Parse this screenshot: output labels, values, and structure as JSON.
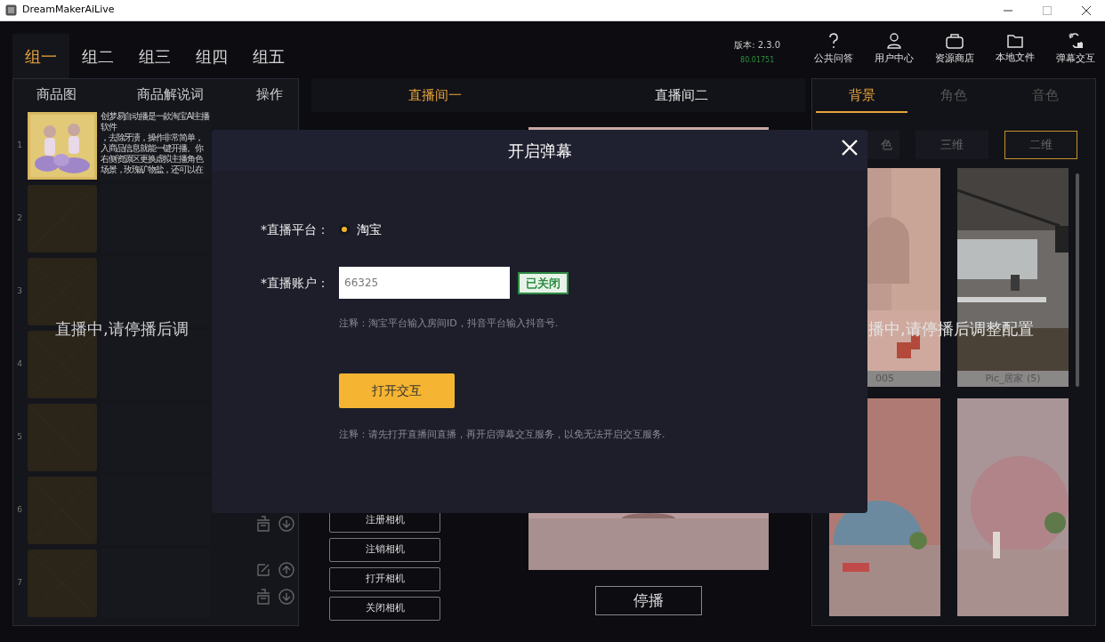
{
  "window": {
    "title": "DreamMakerAiLive"
  },
  "group_tabs": [
    {
      "label": "组一",
      "selected": true
    },
    {
      "label": "组二",
      "selected": false
    },
    {
      "label": "组三",
      "selected": false
    },
    {
      "label": "组四",
      "selected": false
    },
    {
      "label": "组五",
      "selected": false
    }
  ],
  "version": {
    "label": "版本: 2.3.0",
    "build": "80.01751"
  },
  "toolbar": [
    {
      "label": "公共问答",
      "kind": "question"
    },
    {
      "label": "用户中心",
      "kind": "user"
    },
    {
      "label": "资源商店",
      "kind": "bag"
    },
    {
      "label": "本地文件",
      "kind": "folder"
    },
    {
      "label": "弹幕交互",
      "kind": "interact"
    }
  ],
  "product_table": {
    "columns": [
      "商品图",
      "商品解说词",
      "操作"
    ],
    "rows": [
      {
        "number": "1",
        "kind": "picture",
        "description": [
          "创梦易自动播是一款淘宝AI主播软件",
          "，去除牙渍，操作非常简单，",
          "入商品信息就能一键开播。你",
          "右侧资源区更换虚拟主播角色",
          "场景，玫瑰矿物盐，还可以在"
        ],
        "actions": []
      },
      {
        "number": "2",
        "kind": "placeholder",
        "description": [],
        "actions": []
      },
      {
        "number": "3",
        "kind": "placeholder",
        "description": [],
        "actions": []
      },
      {
        "number": "4",
        "kind": "placeholder",
        "description": [],
        "actions": []
      },
      {
        "number": "5",
        "kind": "placeholder",
        "description": [],
        "actions": []
      },
      {
        "number": "6",
        "kind": "placeholder",
        "description": [],
        "actions": [
          {
            "kind": "delete"
          },
          {
            "kind": "down"
          }
        ]
      },
      {
        "number": "7",
        "kind": "placeholder",
        "description": [],
        "actions": [
          {
            "kind": "edit"
          },
          {
            "kind": "up"
          },
          {
            "kind": "delete"
          },
          {
            "kind": "down"
          }
        ]
      }
    ]
  },
  "overlay_notice_left": "直播中,请停播后调",
  "room_tabs": [
    {
      "label": "直播间一",
      "selected": true
    },
    {
      "label": "直播间二",
      "selected": false
    }
  ],
  "camera_buttons": [
    "注册相机",
    "注销相机",
    "打开相机",
    "关闭相机"
  ],
  "stop_button": "停播",
  "resource_tabs": [
    {
      "label": "背景",
      "selected": true
    },
    {
      "label": "角色",
      "selected": false
    },
    {
      "label": "音色",
      "selected": false
    }
  ],
  "style_buttons": [
    {
      "label": "色",
      "selected": false
    },
    {
      "label": "三维",
      "selected": false
    },
    {
      "label": "二维",
      "selected": true
    }
  ],
  "resources": [
    {
      "kind": "picture",
      "caption": "005"
    },
    {
      "kind": "picture",
      "caption": "Pic_居家 (5)"
    },
    {
      "kind": "picture"
    },
    {
      "kind": "picture"
    }
  ],
  "overlay_notice_right": "播中,请停播后调整配置",
  "dialog": {
    "title": "开启弹幕",
    "platform": {
      "label": "*直播平台：",
      "options": [
        {
          "label": "淘宝",
          "selected": true
        }
      ]
    },
    "account": {
      "label": "*直播账户：",
      "value": "66325",
      "status": "已关闭"
    },
    "account_note": "注释：淘宝平台输入房间ID，抖音平台输入抖音号.",
    "primary_button": "打开交互",
    "note": "注释：请先打开直播间直播，再开启弹幕交互服务，以免无法开启交互服务."
  }
}
